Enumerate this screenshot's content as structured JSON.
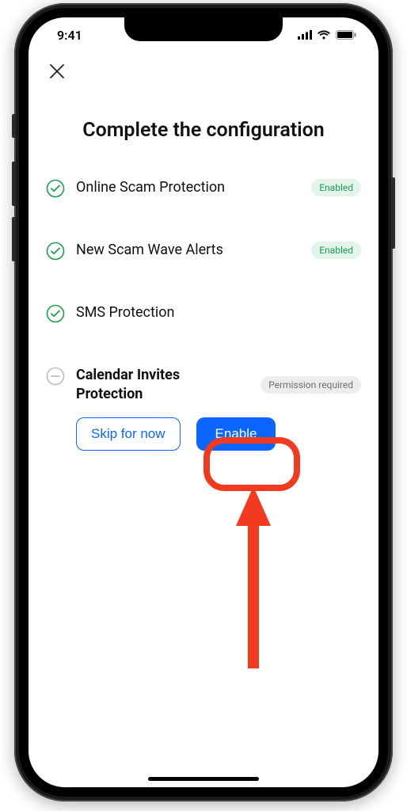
{
  "status": {
    "time": "9:41"
  },
  "page": {
    "title": "Complete the configuration"
  },
  "badges": {
    "enabled": "Enabled",
    "permission_required": "Permission required"
  },
  "items": [
    {
      "label": "Online Scam Protection"
    },
    {
      "label": "New Scam Wave Alerts"
    },
    {
      "label": "SMS Protection"
    },
    {
      "label": "Calendar Invites Protection"
    }
  ],
  "buttons": {
    "skip": "Skip for now",
    "enable": "Enable"
  }
}
